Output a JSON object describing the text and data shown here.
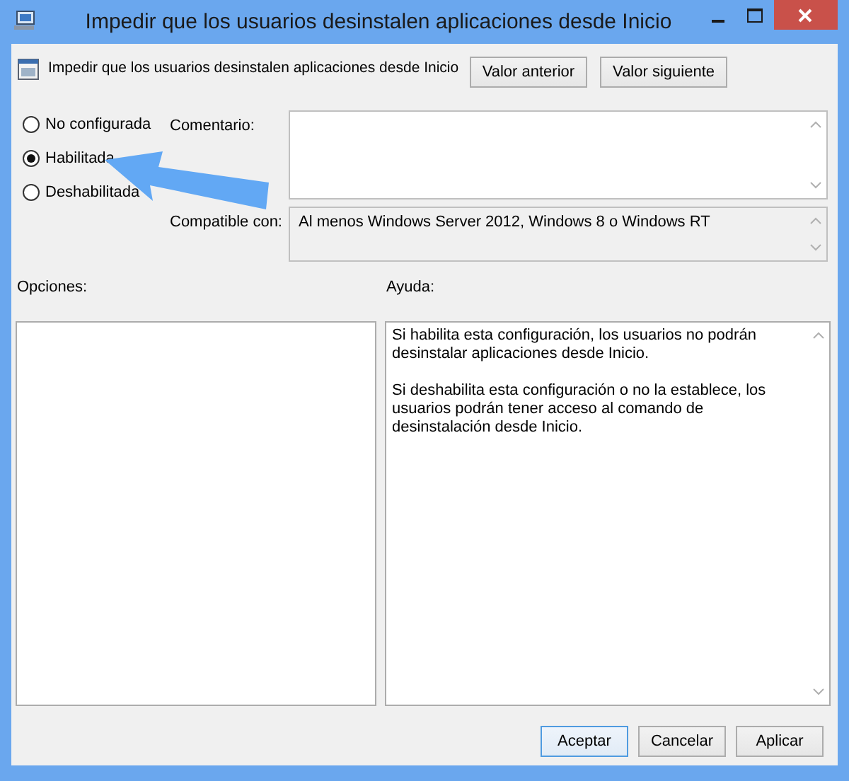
{
  "window": {
    "title": "Impedir que los usuarios desinstalen aplicaciones desde Inicio"
  },
  "policy": {
    "name": "Impedir que los usuarios desinstalen aplicaciones desde Inicio",
    "nav_buttons": [
      "Valor anterior",
      "Valor siguiente"
    ]
  },
  "states": [
    {
      "label": "No configurada",
      "selected": false
    },
    {
      "label": "Habilitada",
      "selected": true
    },
    {
      "label": "Deshabilitada",
      "selected": false
    }
  ],
  "comment": {
    "label": "Comentario:"
  },
  "compatible": {
    "label": "Compatible con:",
    "value": "Al menos Windows Server 2012, Windows 8 o Windows RT"
  },
  "options_panel": {
    "label": "Opciones:"
  },
  "help": {
    "label": "Ayuda:",
    "paragraphs": [
      "Si habilita esta configuración, los usuarios no podrán desinstalar aplicaciones desde Inicio.",
      "Si deshabilita esta configuración o no la establece, los usuarios podrán tener acceso al comando de desinstalación desde Inicio."
    ]
  },
  "buttons": [
    {
      "label": "Aceptar",
      "focused": true
    },
    {
      "label": "Cancelar",
      "focused": false
    },
    {
      "label": "Aplicar",
      "focused": false
    }
  ],
  "annotation": {
    "kind": "arrow"
  }
}
